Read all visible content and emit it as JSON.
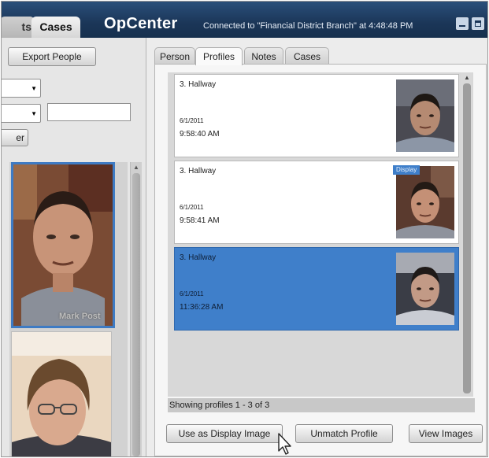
{
  "topbar": {
    "tabs": [
      {
        "label": "ts"
      },
      {
        "label": "Cases"
      }
    ],
    "brand": "OpCenter",
    "status": "Connected to \"Financial District Branch\" at 4:48:48 PM"
  },
  "left_panel": {
    "export_button": "Export People",
    "filter_button": "er",
    "thumbnails": [
      {
        "caption": "Mark Post"
      },
      {
        "caption": ""
      }
    ]
  },
  "right_panel": {
    "tabs": [
      {
        "label": "Person",
        "active": false
      },
      {
        "label": "Profiles",
        "active": true
      },
      {
        "label": "Notes",
        "active": false
      },
      {
        "label": "Cases",
        "active": false
      }
    ],
    "profiles": [
      {
        "location": "3. Hallway",
        "date": "6/1/2011",
        "time": "9:58:40 AM",
        "selected": false,
        "badge": ""
      },
      {
        "location": "3. Hallway",
        "date": "6/1/2011",
        "time": "9:58:41 AM",
        "selected": false,
        "badge": "Display"
      },
      {
        "location": "3. Hallway",
        "date": "6/1/2011",
        "time": "11:36:28 AM",
        "selected": true,
        "badge": ""
      }
    ],
    "showing_text": "Showing profiles 1 - 3 of 3",
    "buttons": {
      "use_display": "Use as Display Image",
      "unmatch": "Unmatch Profile",
      "view_images": "View Images"
    }
  },
  "colors": {
    "topbar": "#1b3658",
    "selection": "#3f7fca"
  },
  "icons": [
    "minimize-icon",
    "maximize-icon",
    "dropdown-arrow-icon",
    "scroll-up-arrow-icon",
    "scroll-down-arrow-icon",
    "mouse-cursor-icon"
  ]
}
